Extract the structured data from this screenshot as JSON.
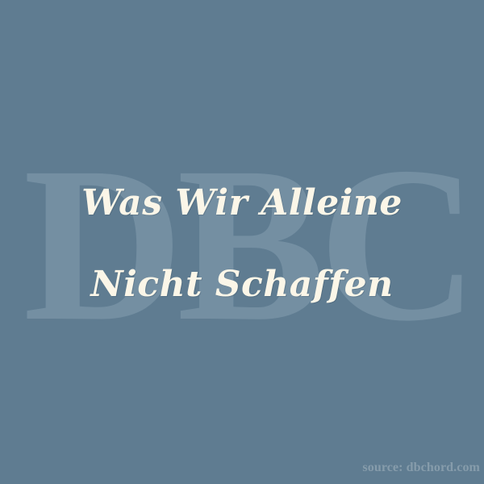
{
  "watermark": {
    "text": "DBC"
  },
  "title": {
    "line1": "Was Wir Alleine",
    "line2": "Nicht Schaffen"
  },
  "source": {
    "text": "source: dbchord.com"
  },
  "colors": {
    "background": "#5f7c91",
    "title_text": "#fbf6e8",
    "watermark_text": "#7a95a8",
    "source_text": "#869cab"
  }
}
